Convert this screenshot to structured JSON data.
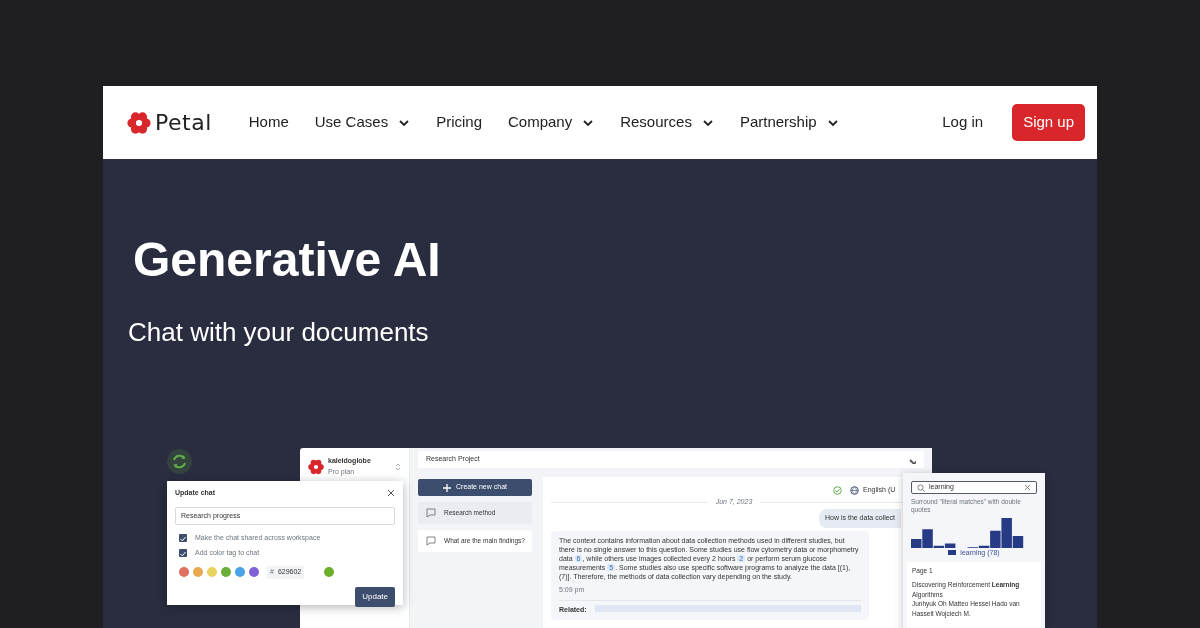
{
  "navbar": {
    "brand": "Petal",
    "links": [
      {
        "label": "Home",
        "has_menu": false
      },
      {
        "label": "Use Cases",
        "has_menu": true
      },
      {
        "label": "Pricing",
        "has_menu": false
      },
      {
        "label": "Company",
        "has_menu": true
      },
      {
        "label": "Resources",
        "has_menu": true
      },
      {
        "label": "Partnership",
        "has_menu": true
      }
    ],
    "login": "Log in",
    "signup": "Sign up"
  },
  "hero": {
    "title": "Generative AI",
    "subtitle": "Chat with your documents"
  },
  "app": {
    "workspace": {
      "name": "kaleidoglobe",
      "plan": "Pro plan"
    },
    "project": "Research Project",
    "new_chat": "Create new chat",
    "chats": [
      {
        "label": "Research method",
        "selected": true
      },
      {
        "label": "What are the main findings?",
        "selected": false
      }
    ],
    "language": "English (U",
    "date": "Jun 7, 2023",
    "question": "How is the data collect",
    "answer": [
      {
        "kind": "text",
        "text": "The context contains information about data collection methods used in different studies, but there is no single answer to this question. Some studies use flow cytometry data or morphometry data "
      },
      {
        "kind": "cite",
        "text": "6"
      },
      {
        "kind": "text",
        "text": ", while others use images collected every 2 hours "
      },
      {
        "kind": "cite",
        "text": "2"
      },
      {
        "kind": "text",
        "text": " or perform serum glucose measurements "
      },
      {
        "kind": "cite",
        "text": "5"
      },
      {
        "kind": "text",
        "text": ". Some studies also use specific software programs to analyze the data [(1), (7)]. Therefore, the methods of data collection vary depending on the study."
      }
    ],
    "answer_time": "5:09 pm",
    "related_label": "Related:"
  },
  "dialog": {
    "title": "Update chat",
    "name_value": "Research progress",
    "options": [
      {
        "label": "Make the chat shared across workspace",
        "checked": true
      },
      {
        "label": "Add color tag to chat",
        "checked": true
      }
    ],
    "swatches": [
      {
        "color": "#e0705c"
      },
      {
        "color": "#e8a850"
      },
      {
        "color": "#e8d45c"
      },
      {
        "color": "#6aae3a"
      },
      {
        "color": "#4aa3e8"
      },
      {
        "color": "#7f62d8"
      }
    ],
    "hex_prefix": "#",
    "hex_value": "629602",
    "preview": {
      "color": "#6aae2a"
    },
    "button": "Update"
  },
  "search": {
    "query": "learning",
    "hint": "Surround \"literal matches\" with double quotes",
    "legend": "learning (78)",
    "page": "Page 1",
    "result_title": "Discovering Reinforcement **Learning** Algorithms",
    "result_authors": "Junhyuk Oh Matteo Hessel Hado van Hasselt Wojciech M."
  }
}
